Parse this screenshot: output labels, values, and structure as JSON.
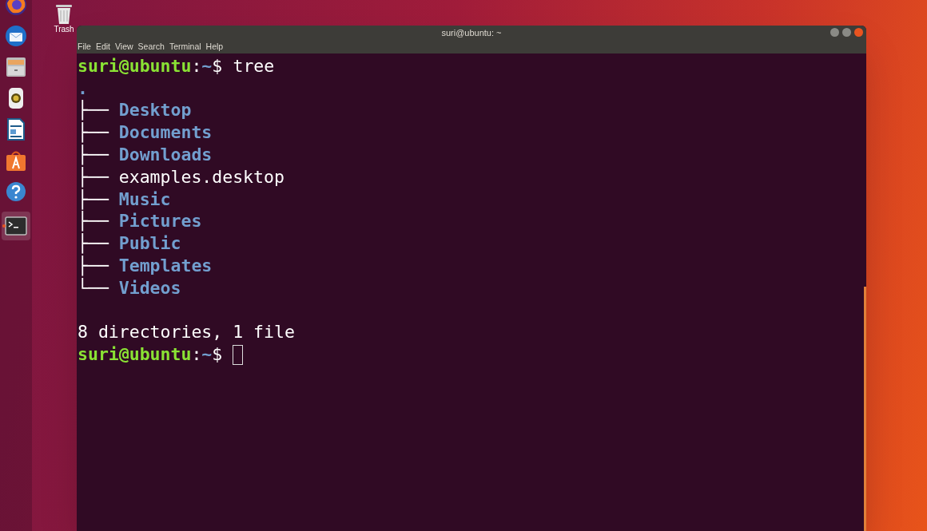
{
  "dock": [
    {
      "kind": "browser",
      "active": false
    },
    {
      "kind": "mail",
      "active": false
    },
    {
      "kind": "files",
      "active": false
    },
    {
      "kind": "music",
      "active": false
    },
    {
      "kind": "writer",
      "active": false
    },
    {
      "kind": "store",
      "active": false
    },
    {
      "kind": "help",
      "active": false
    },
    {
      "kind": "terminal",
      "active": true
    }
  ],
  "desktop_icons": [
    {
      "label": "Trash"
    }
  ],
  "window": {
    "title": "suri@ubuntu: ~",
    "menu": [
      "File",
      "Edit",
      "View",
      "Search",
      "Terminal",
      "Help"
    ]
  },
  "terminal": {
    "lines": [
      {
        "kind": "prompt",
        "user": "suri@ubuntu",
        "sep": ":",
        "path": "~",
        "symbol": "$",
        "command": "tree"
      },
      {
        "kind": "tree",
        "root": ".",
        "children": [
          {
            "prefix": "├── ",
            "name": "Desktop",
            "kind": "dir"
          },
          {
            "prefix": "├── ",
            "name": "Documents",
            "kind": "dir"
          },
          {
            "prefix": "├── ",
            "name": "Downloads",
            "kind": "dir"
          },
          {
            "prefix": "├── ",
            "name": "examples.desktop",
            "kind": "file"
          },
          {
            "prefix": "├── ",
            "name": "Music",
            "kind": "dir"
          },
          {
            "prefix": "├── ",
            "name": "Pictures",
            "kind": "dir"
          },
          {
            "prefix": "├── ",
            "name": "Public",
            "kind": "dir"
          },
          {
            "prefix": "├── ",
            "name": "Templates",
            "kind": "dir"
          },
          {
            "prefix": "└── ",
            "name": "Videos",
            "kind": "dir"
          }
        ]
      },
      {
        "kind": "blank"
      },
      {
        "kind": "output",
        "text": "8 directories, 1 file"
      },
      {
        "kind": "prompt",
        "user": "suri@ubuntu",
        "sep": ":",
        "path": "~",
        "symbol": "$",
        "cursor": true
      }
    ]
  }
}
